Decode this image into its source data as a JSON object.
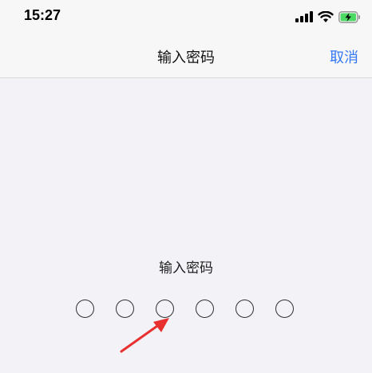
{
  "status_bar": {
    "time": "15:27",
    "icons": [
      "cellular-signal-icon",
      "wifi-icon",
      "battery-charging-icon"
    ]
  },
  "nav": {
    "title": "输入密码",
    "cancel_label": "取消"
  },
  "passcode": {
    "prompt": "输入密码",
    "digit_count": 6,
    "digits_entered": 0
  },
  "colors": {
    "accent": "#3478f6",
    "battery": "#4cd964",
    "annotation_arrow": "#e8312f",
    "background": "#f2f2f7"
  }
}
